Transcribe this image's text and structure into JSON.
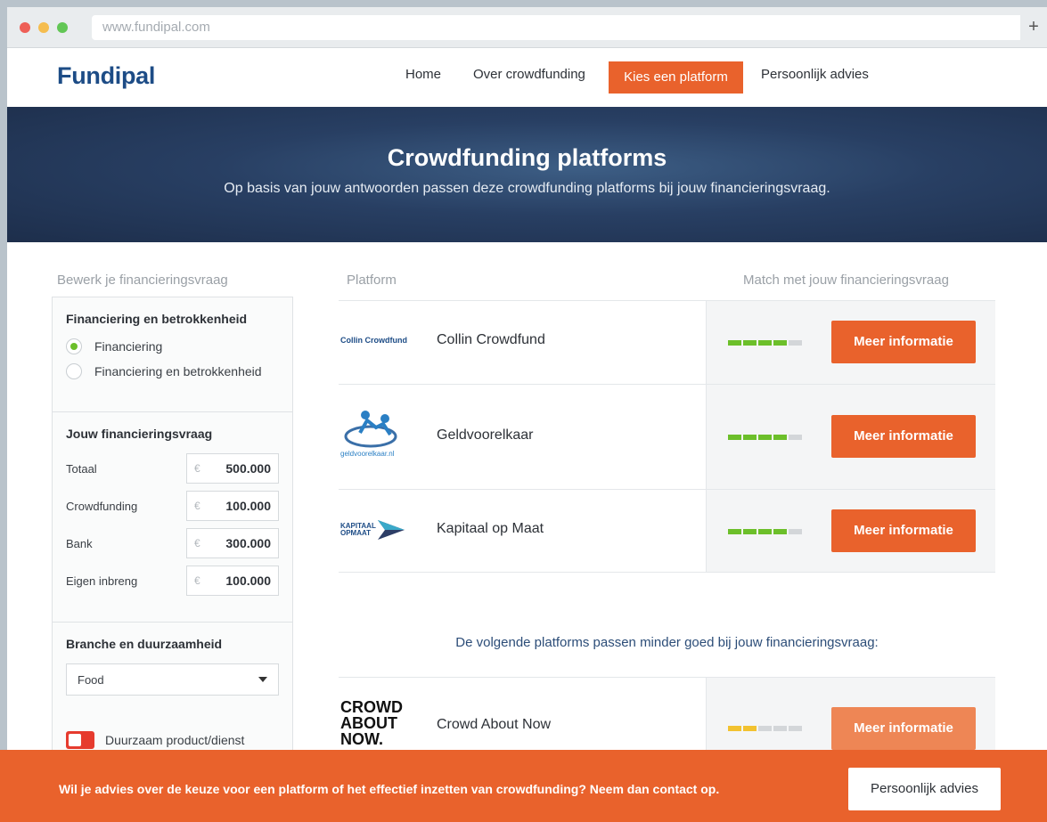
{
  "browser": {
    "url": "www.fundipal.com",
    "new_tab_label": "+",
    "traffic_colors": [
      "#ee5f57",
      "#f5bd4f",
      "#62c655"
    ]
  },
  "nav": {
    "logo": "Fundipal",
    "items": [
      "Home",
      "Over crowdfunding",
      "Kies een platform",
      "Persoonlijk advies"
    ],
    "active_index": 2
  },
  "hero": {
    "title": "Crowdfunding platforms",
    "subtitle": "Op basis van jouw antwoorden passen deze crowdfunding platforms bij jouw financieringsvraag."
  },
  "sidebar": {
    "heading": "Bewerk je financieringsvraag",
    "type_section": {
      "title": "Financiering en betrokkenheid",
      "options": [
        "Financiering",
        "Financiering en betrokkenheid"
      ],
      "selected_index": 0
    },
    "amounts_section": {
      "title": "Jouw financieringsvraag",
      "currency": "€",
      "fields": [
        {
          "label": "Totaal",
          "value": "500.000"
        },
        {
          "label": "Crowdfunding",
          "value": "100.000"
        },
        {
          "label": "Bank",
          "value": "300.000"
        },
        {
          "label": "Eigen inbreng",
          "value": "100.000"
        }
      ]
    },
    "branche_section": {
      "title": "Branche en duurzaamheid",
      "selected": "Food",
      "toggle_label": "Duurzaam product/dienst",
      "toggle_on": false
    }
  },
  "results": {
    "col_platform": "Platform",
    "col_match": "Match met jouw financieringsvraag",
    "button_label": "Meer informatie",
    "platforms": [
      {
        "name": "Collin Crowdfund",
        "logo_text": "Collin Crowdfund",
        "match": 4,
        "of": 5
      },
      {
        "name": "Geldvoorelkaar",
        "logo_text": "geldvoorelkaar.nl",
        "match": 4,
        "of": 5
      },
      {
        "name": "Kapitaal op Maat",
        "logo_text": "KAPITAAL OPMAAT",
        "match": 4,
        "of": 5
      }
    ],
    "less_heading": "De volgende platforms passen minder goed bij jouw financieringsvraag:",
    "less_platforms": [
      {
        "name": "Crowd About Now",
        "logo_text": "CROWD ABOUT NOW.",
        "match": 2,
        "of": 5
      }
    ]
  },
  "cta": {
    "text": "Wil je advies over de keuze voor een platform of het effectief inzetten van crowdfunding? Neem dan contact op.",
    "button": "Persoonlijk advies"
  },
  "colors": {
    "accent": "#e9622c",
    "brand": "#1d4c86",
    "match_good": "#6cbf2a",
    "match_weak": "#f2c230"
  }
}
